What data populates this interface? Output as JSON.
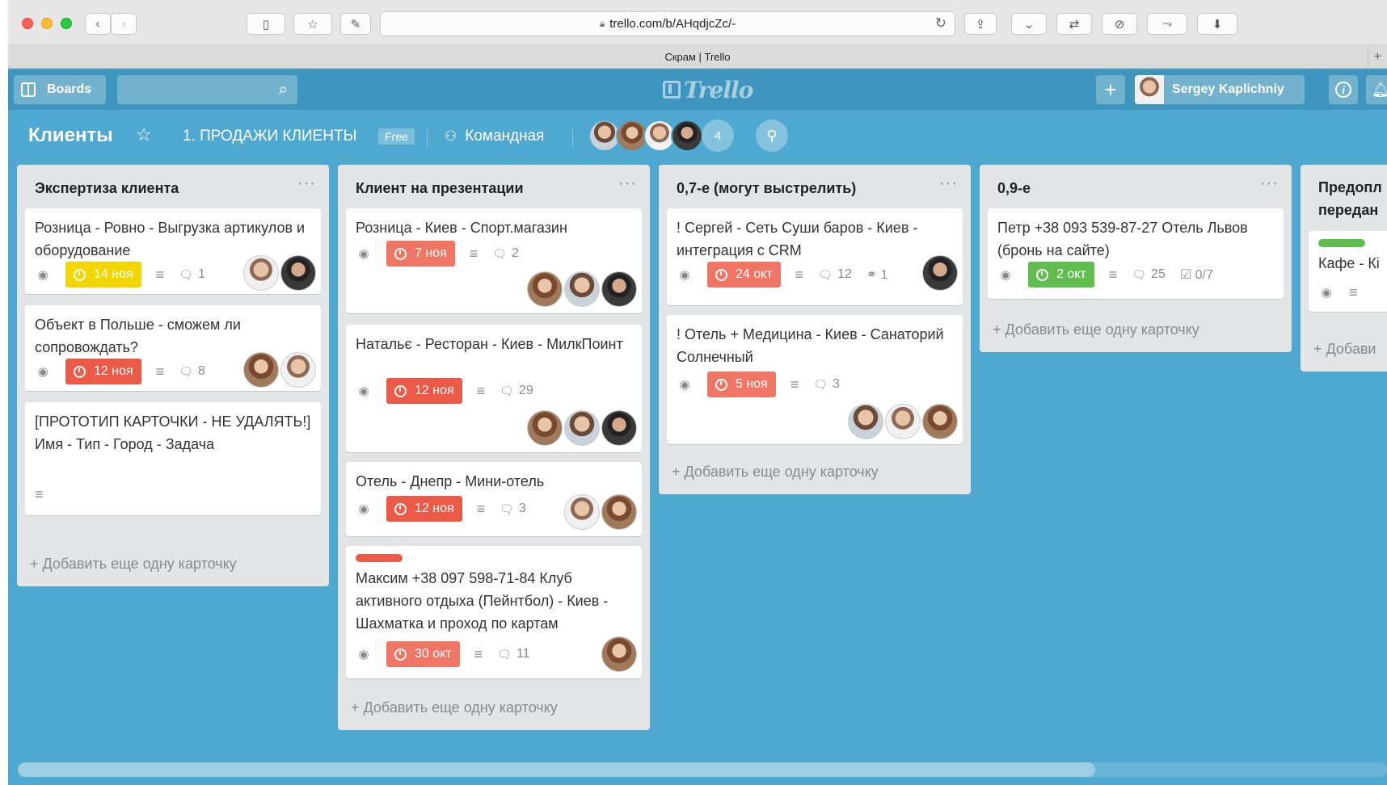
{
  "browser": {
    "url": "trello.com/b/AHqdjcZc/-",
    "tab_title": "Скрам | Trello"
  },
  "header": {
    "boards_label": "Boards",
    "logo_text": "Trello",
    "user_name": "Sergey Kaplichniy"
  },
  "board": {
    "title": "Клиенты",
    "team_name": "1. ПРОДАЖИ КЛИЕНТЫ",
    "plan_badge": "Free",
    "visibility": "Командная",
    "member_count": "4"
  },
  "lists": [
    {
      "title": "Экспертиза клиента",
      "add_card": "Добавить еще одну карточку",
      "cards": [
        {
          "text": "Розница - Ровно - Выгрузка артикулов и оборудование",
          "due": "14 ноя",
          "due_color": "#f2d600",
          "comments": "1"
        },
        {
          "text": "Объект в Польше - сможем ли сопровождать?",
          "due": "12 ноя",
          "due_color": "#eb5a46",
          "comments": "8"
        },
        {
          "text": "[ПРОТОТИП КАРТОЧКИ - НЕ УДАЛЯТЬ!] Имя - Тип - Город - Задача"
        }
      ]
    },
    {
      "title": "Клиент на презентации",
      "add_card": "Добавить еще одну карточку",
      "cards": [
        {
          "text": "Розница - Киев - Спорт.магазин",
          "due": "7 ноя",
          "due_color": "#ef7564",
          "comments": "2"
        },
        {
          "text": "Натальє - Ресторан - Киев - МилкПоинт",
          "due": "12 ноя",
          "due_color": "#eb5a46",
          "comments": "29"
        },
        {
          "text": "Отель - Днепр - Мини-отель",
          "due": "12 ноя",
          "due_color": "#eb5a46",
          "comments": "3"
        },
        {
          "label_color": "#eb5a46",
          "text": "Максим +38 097 598-71-84 Клуб активного отдыха (Пейнтбол) - Киев - Шахматка и проход по картам",
          "due": "30 окт",
          "due_color": "#ef7564",
          "comments": "11"
        }
      ]
    },
    {
      "title": "0,7-е (могут выстрелить)",
      "add_card": "Добавить еще одну карточку",
      "cards": [
        {
          "text": "! Сергей - Сеть Суши баров - Киев - интеграция с CRM",
          "due": "24 окт",
          "due_color": "#ef7564",
          "comments": "12",
          "attachments": "1"
        },
        {
          "text": "! Отель + Медицина - Киев - Санаторий Солнечный",
          "due": "5 ноя",
          "due_color": "#ef7564",
          "comments": "3"
        }
      ]
    },
    {
      "title": "0,9-е",
      "add_card": "Добавить еще одну карточку",
      "cards": [
        {
          "text": "Петр +38 093 539-87-27 Отель Львов (бронь на сайте)",
          "due": "2 окт",
          "due_color": "#61bd4f",
          "comments": "25",
          "checklist": "0/7"
        }
      ]
    },
    {
      "title": "Предопл передан",
      "add_card": "Добави",
      "cards": [
        {
          "label_color": "#61bd4f",
          "text": "Кафе - Кі"
        }
      ]
    }
  ]
}
